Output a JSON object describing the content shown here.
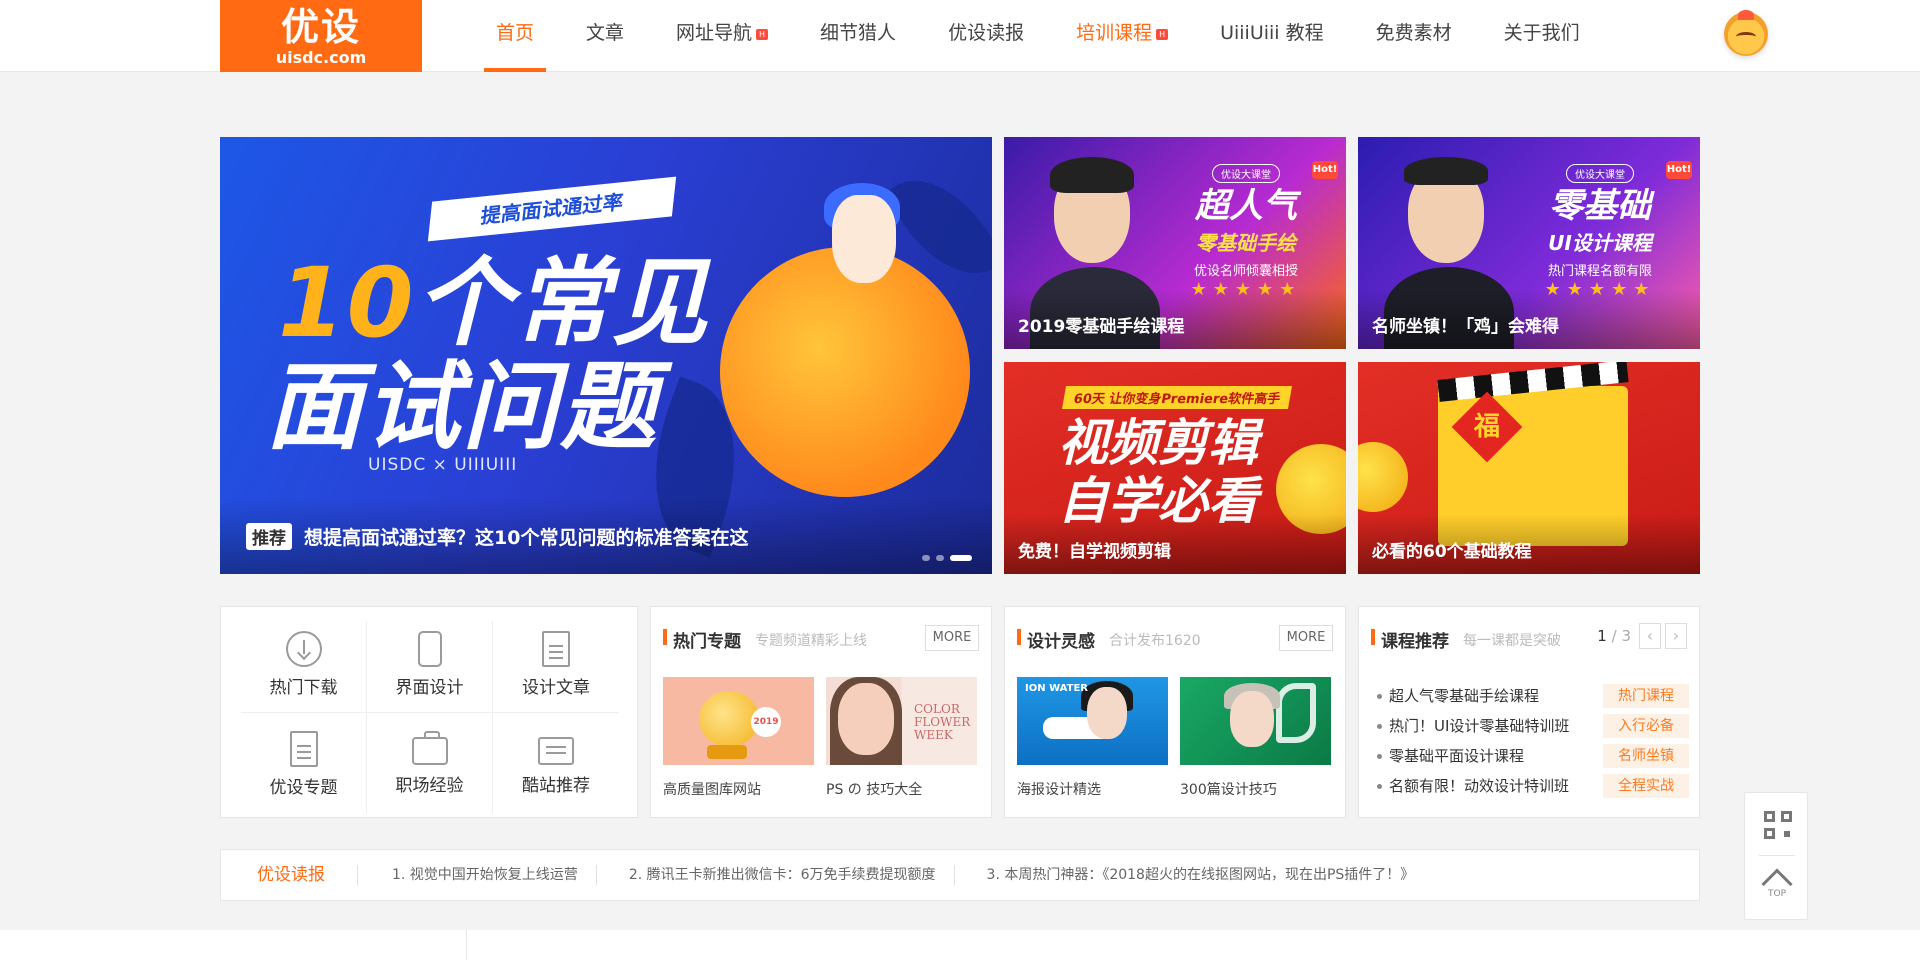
{
  "logo": {
    "name": "优设",
    "domain": "uisdc.com"
  },
  "nav": {
    "items": [
      {
        "label": "首页",
        "state": "active"
      },
      {
        "label": "文章"
      },
      {
        "label": "网址导航",
        "hot": true
      },
      {
        "label": "细节猎人"
      },
      {
        "label": "优设读报"
      },
      {
        "label": "培训课程",
        "hot": true,
        "highlight": true
      },
      {
        "label": "UiiiUiii 教程"
      },
      {
        "label": "免费素材"
      },
      {
        "label": "关于我们"
      }
    ],
    "hot_mark": "H"
  },
  "banner": {
    "ribbon": "提高面试通过率",
    "headline_num": "10",
    "headline_rest": "个常见",
    "headline_line2": "面试问题",
    "sub": "UISDC × UIIIUIII",
    "tag": "推荐",
    "title": "想提高面试通过率？这10个常见问题的标准答案在这",
    "slides": 3,
    "active_slide": 3
  },
  "tiles": [
    {
      "title": "2019零基础手绘课程",
      "pill": "优设大课堂",
      "head": "超人气",
      "head2": "零基础手绘",
      "sub": "优设名师倾囊相授",
      "stars": "★★★★★",
      "badge": "Hot!"
    },
    {
      "title": "名师坐镇！「鸡」会难得",
      "pill": "优设大课堂",
      "head": "零基础",
      "head2": "UI设计课程",
      "sub": "热门课程名额有限",
      "stars": "★★★★★",
      "badge": "Hot!"
    },
    {
      "title": "免费！自学视频剪辑",
      "top": "60天 让你变身Premiere软件高手",
      "head": "视频剪辑\n自学必看"
    },
    {
      "title": "必看的60个基础教程",
      "fu": "福"
    }
  ],
  "categories": [
    {
      "label": "热门下载",
      "icon": "download-icon"
    },
    {
      "label": "界面设计",
      "icon": "phone-icon"
    },
    {
      "label": "设计文章",
      "icon": "document-icon"
    },
    {
      "label": "优设专题",
      "icon": "topic-icon"
    },
    {
      "label": "职场经验",
      "icon": "briefcase-icon"
    },
    {
      "label": "酷站推荐",
      "icon": "monitor-icon"
    }
  ],
  "hot_topics": {
    "title": "热门专题",
    "subtitle": "专题频道精彩上线",
    "more": "MORE",
    "items": [
      {
        "caption": "高质量图库网站",
        "badge": "2019"
      },
      {
        "caption": "PS の 技巧大全",
        "art": "COLOR FLOWER WEEK"
      }
    ]
  },
  "inspiration": {
    "title": "设计灵感",
    "subtitle": "合计发布1620",
    "more": "MORE",
    "items": [
      {
        "caption": "海报设计精选",
        "art": "ION WATER"
      },
      {
        "caption": "300篇设计技巧"
      }
    ]
  },
  "courses": {
    "title": "课程推荐",
    "subtitle": "每一课都是突破",
    "page": "1",
    "total": "/ 3",
    "prev": "‹",
    "next": "›",
    "items": [
      {
        "name": "超人气零基础手绘课程",
        "tag": "热门课程"
      },
      {
        "name": "热门！UI设计零基础特训班",
        "tag": "入行必备"
      },
      {
        "name": "零基础平面设计课程",
        "tag": "名师坐镇"
      },
      {
        "name": "名额有限！动效设计特训班",
        "tag": "全程实战"
      }
    ]
  },
  "news": {
    "label": "优设读报",
    "items": [
      "1. 视觉中国开始恢复上线运营",
      "2. 腾讯王卡新推出微信卡：6万免手续费提现额度",
      "3. 本周热门神器：《2018超火的在线抠图网站，现在出PS插件了！》"
    ]
  },
  "sidetool": {
    "top_label": "TOP"
  },
  "colors": {
    "accent": "#ff6a13",
    "tag_bg": "#fdf0e4"
  }
}
